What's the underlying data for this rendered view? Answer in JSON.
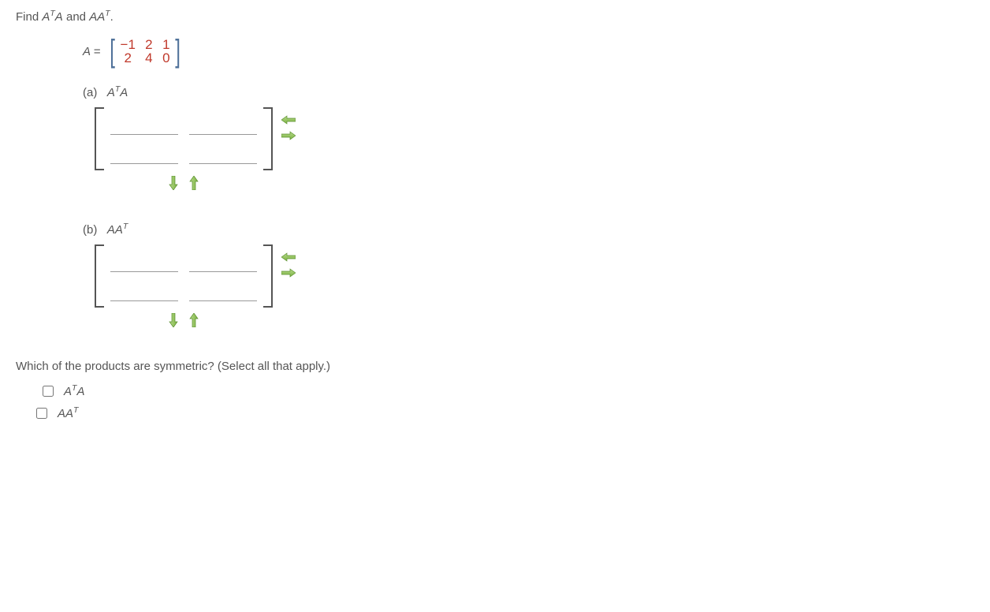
{
  "question": {
    "prompt_prefix": "Find ",
    "term1_a": "A",
    "term1_T": "T",
    "term1_a2": "A",
    "and": " and ",
    "term2_a": "AA",
    "term2_T": "T",
    "suffix": "."
  },
  "matrixA": {
    "label": "A =",
    "cells": [
      "−1",
      "2",
      "1",
      "2",
      "4",
      "0"
    ]
  },
  "parts": {
    "a": {
      "label": "(a)",
      "expr_a": "A",
      "expr_T": "T",
      "expr_a2": "A"
    },
    "b": {
      "label": "(b)",
      "expr_a": "AA",
      "expr_T": "T",
      "expr_a2": ""
    }
  },
  "symmetric": {
    "prompt": "Which of the products are symmetric? (Select all that apply.)",
    "opt1_a": "A",
    "opt1_T": "T",
    "opt1_a2": "A",
    "opt2_a": "AA",
    "opt2_T": "T",
    "opt2_a2": ""
  },
  "icons": {
    "left": "←",
    "right": "→",
    "down": "↓",
    "up": "↑"
  }
}
